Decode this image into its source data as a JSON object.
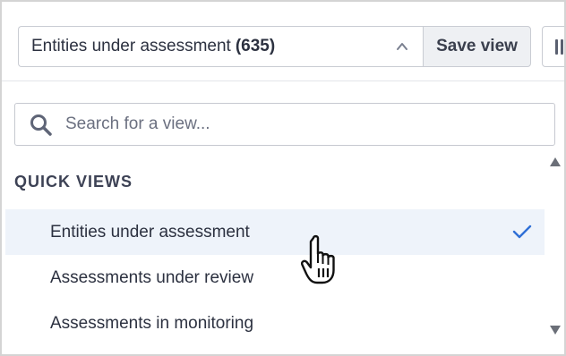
{
  "view_selector": {
    "label": "Entities under assessment",
    "count": "(635)",
    "toggle_icon": "chevron-up-icon"
  },
  "toolbar": {
    "save_label": "Save view",
    "columns_icon": "columns-icon"
  },
  "search": {
    "placeholder": "Search for a view...",
    "value": "",
    "icon": "search-icon"
  },
  "quick_views": {
    "title": "QUICK VIEWS",
    "items": [
      {
        "label": "Entities under assessment",
        "selected": true
      },
      {
        "label": "Assessments under review",
        "selected": false
      },
      {
        "label": "Assessments in monitoring",
        "selected": false
      }
    ]
  },
  "colors": {
    "selected_bg": "#eef3fa",
    "check": "#2f6fd6",
    "border": "#c9ccd3",
    "text": "#2c3140"
  }
}
